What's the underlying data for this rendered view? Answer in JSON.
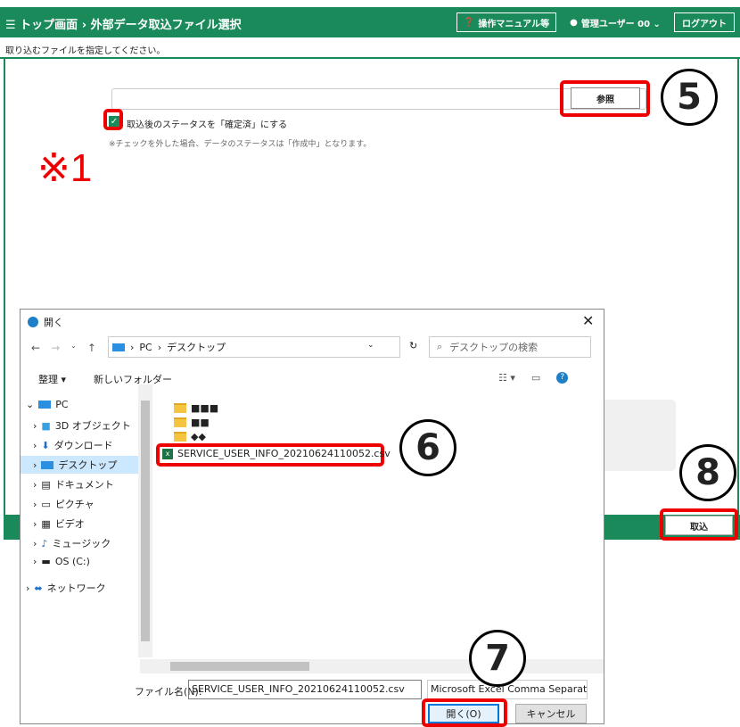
{
  "app": {
    "title": "☰ トップ画面 › 外部データ取込ファイル選択",
    "manual_label": "操作マニュアル等",
    "user_label": "管理ユーザー 00 ⌄",
    "logout_label": "ログアウト",
    "instruction": "取り込むファイルを指定してください。",
    "browse_label": "参照",
    "checkbox_label": "取込後のステータスを「確定済」にする",
    "note": "※チェックを外した場合、データのステータスは「作成中」となります。",
    "import_label": "取込",
    "checkbox_checked": true
  },
  "annotations": {
    "note_mark": "※1",
    "step5": "5",
    "step6": "6",
    "step7": "7",
    "step8": "8"
  },
  "dialog": {
    "title": "開く",
    "path_pc": "PC",
    "path_desktop": "デスクトップ",
    "search_placeholder": "デスクトップの検索",
    "organize_label": "整理 ▾",
    "new_folder_label": "新しいフォルダー",
    "tree": [
      "PC",
      "3D オブジェクト",
      "ダウンロード",
      "デスクトップ",
      "ドキュメント",
      "ピクチャ",
      "ビデオ",
      "ミュージック",
      "OS (C:)",
      "ネットワーク"
    ],
    "files": [
      "■■■",
      "■■",
      "◆◆",
      "SERVICE_USER_INFO_20210624110052.csv"
    ],
    "filename_label": "ファイル名(N):",
    "filename_value": "SERVICE_USER_INFO_20210624110052.csv",
    "filetype_value": "Microsoft Excel Comma Separat",
    "open_label": "開く(O)",
    "cancel_label": "キャンセル"
  },
  "colors": {
    "brand": "#1b8a5a",
    "highlight": "#e00000"
  }
}
